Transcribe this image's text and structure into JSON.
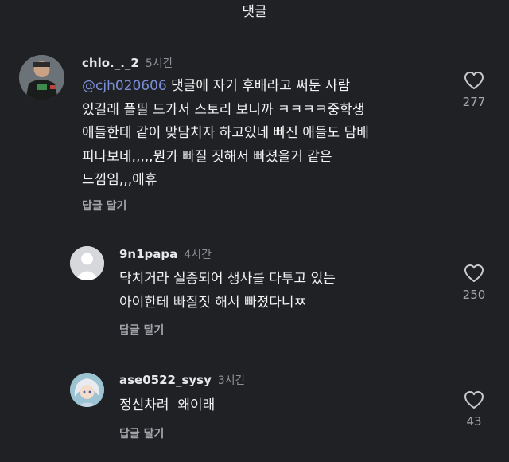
{
  "header": {
    "title": "댓글"
  },
  "comments": [
    {
      "username": "chlo._._2",
      "time": "5시간",
      "mention": "@cjh020606",
      "text": " 댓글에 자기 후배라고 써둔 사람\n있길래 플필 드가서 스토리 보니까 ㅋㅋㅋㅋ중학생\n애들한테 같이 맞담치자 하고있네 빠진 애들도 담배\n피나보네,,,,,뭔가 빠질 짓해서 빠졌을거 같은\n느낌임,,,에휴",
      "reply_label": "답글 달기",
      "likes": "277",
      "like_icon": "heart-outline"
    },
    {
      "username": "9n1papa",
      "time": "4시간",
      "text": "닥치거라 실종되어 생사를 다투고 있는\n아이한테 빠질짓 해서 빠졌다니ㅉ",
      "reply_label": "답글 달기",
      "likes": "250",
      "like_icon": "heart-outline"
    },
    {
      "username": "ase0522_sysy",
      "time": "3시간",
      "text": "정신차려  왜이래",
      "reply_label": "답글 달기",
      "likes": "43",
      "like_icon": "heart-outline"
    }
  ],
  "colors": {
    "background": "#1f2125",
    "mention": "#7b8fd8",
    "secondary_text": "#8f9096"
  }
}
